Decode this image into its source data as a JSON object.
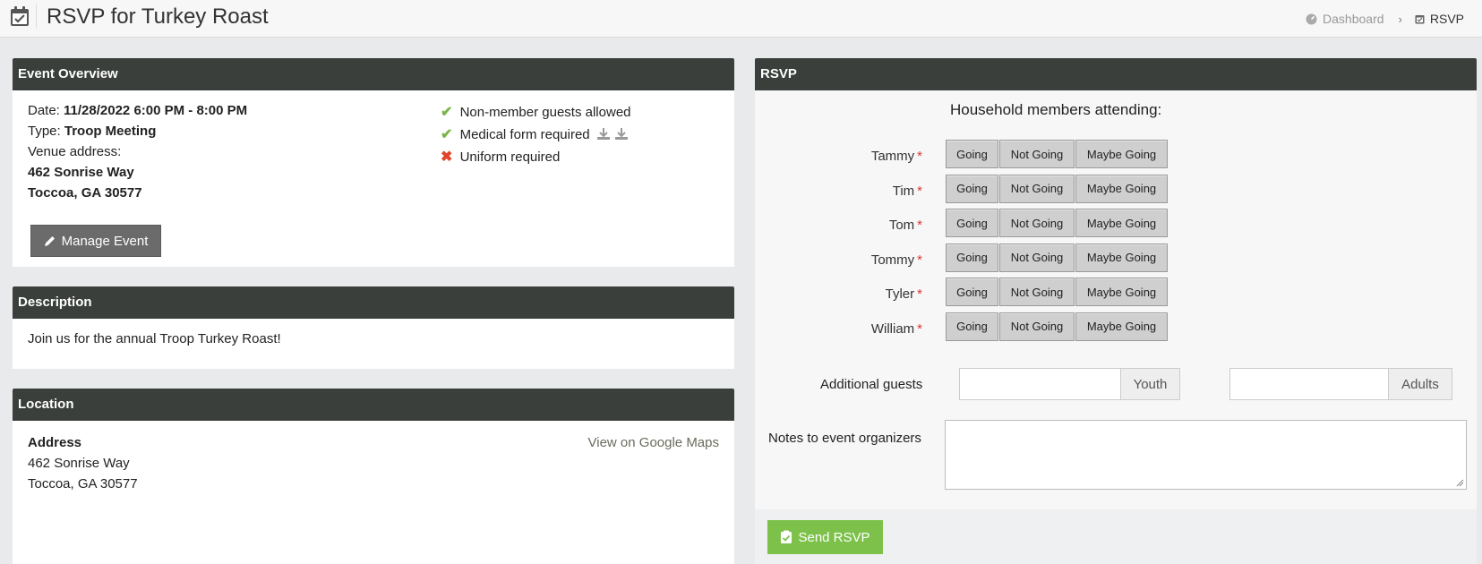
{
  "header": {
    "title": "RSVP for Turkey Roast",
    "breadcrumb": {
      "home": "Dashboard",
      "current": "RSVP"
    }
  },
  "overview": {
    "heading": "Event Overview",
    "date_label": "Date:",
    "date_value": "11/28/2022 6:00 PM - 8:00 PM",
    "type_label": "Type:",
    "type_value": "Troop Meeting",
    "venue_label": "Venue address:",
    "venue_line1": "462 Sonrise Way",
    "venue_line2": "Toccoa, GA 30577",
    "manage_label": "Manage Event",
    "features": [
      {
        "label": "Non-member guests allowed",
        "status": "yes"
      },
      {
        "label": "Medical form required",
        "status": "yes"
      },
      {
        "label": "Uniform required",
        "status": "no"
      }
    ]
  },
  "description": {
    "heading": "Description",
    "text": "Join us for the annual Troop Turkey Roast!"
  },
  "location": {
    "heading": "Location",
    "address_label": "Address",
    "line1": "462 Sonrise Way",
    "line2": "Toccoa, GA 30577",
    "map_link": "View on Google Maps"
  },
  "rsvp": {
    "heading": "RSVP",
    "members_heading": "Household members attending:",
    "required_mark": "*",
    "options": {
      "going": "Going",
      "not_going": "Not Going",
      "maybe": "Maybe Going"
    },
    "members": [
      "Tammy",
      "Tim",
      "Tom",
      "Tommy",
      "Tyler",
      "William"
    ],
    "guests_label": "Additional guests",
    "youth_addon": "Youth",
    "adults_addon": "Adults",
    "notes_label": "Notes to event organizers",
    "send_label": "Send RSVP"
  },
  "colors": {
    "panel_header": "#3a3f3b",
    "check": "#7ab648",
    "cross": "#e0442b",
    "send_button": "#7dc14a"
  }
}
